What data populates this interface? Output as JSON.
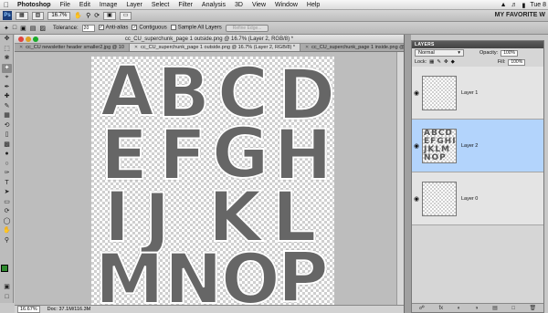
{
  "menubar": {
    "apple": "",
    "app_name": "Photoshop",
    "items": [
      "File",
      "Edit",
      "Image",
      "Layer",
      "Select",
      "Filter",
      "Analysis",
      "3D",
      "View",
      "Window",
      "Help"
    ],
    "clock": "Tue 8"
  },
  "appbar": {
    "ps_logo": "Ps",
    "zoom": "16.7%",
    "workspace": "MY FAVORITE W"
  },
  "options": {
    "tolerance_label": "Tolerance:",
    "tolerance_value": "20",
    "anti_alias": "Anti-alias",
    "contiguous": "Contiguous",
    "sample_all_layers": "Sample All Layers",
    "refine_edge": "Refine Edge..."
  },
  "document": {
    "title": "cc_CU_superchunk_page 1 outside.png @ 16.7% (Layer 2, RGB/8) *",
    "tabs": [
      {
        "label": "cc_CU newsletter header smaller2.jpg @ 10"
      },
      {
        "label": "cc_CU_superchunk_page 1 outside.png @ 16.7% (Layer 2, RGB/8) *"
      },
      {
        "label": "cc_CU_superchunk_page 1 inside.png @ 16.7"
      }
    ],
    "letters": [
      "A",
      "B",
      "C",
      "D",
      "E",
      "F",
      "G",
      "H",
      "I",
      "J",
      "K",
      "L",
      "M",
      "N",
      "O",
      "P"
    ],
    "status_zoom": "16.67%",
    "status_doc": "Doc: 37.1M/116.3M"
  },
  "layers_panel": {
    "title": "LAYERS",
    "blend_mode": "Normal",
    "opacity_label": "Opacity:",
    "opacity_value": "100%",
    "lock_label": "Lock:",
    "fill_label": "Fill:",
    "fill_value": "100%",
    "layers": [
      {
        "name": "Layer 1",
        "thumb": ""
      },
      {
        "name": "Layer 2",
        "thumb": "ABCDEFGHIJKLMNOP"
      },
      {
        "name": "Layer 0",
        "thumb": ""
      }
    ]
  },
  "colors": {
    "foreground": "#2e8a2e",
    "background": "#ffffff",
    "selected_layer": "#b3d4fc"
  }
}
